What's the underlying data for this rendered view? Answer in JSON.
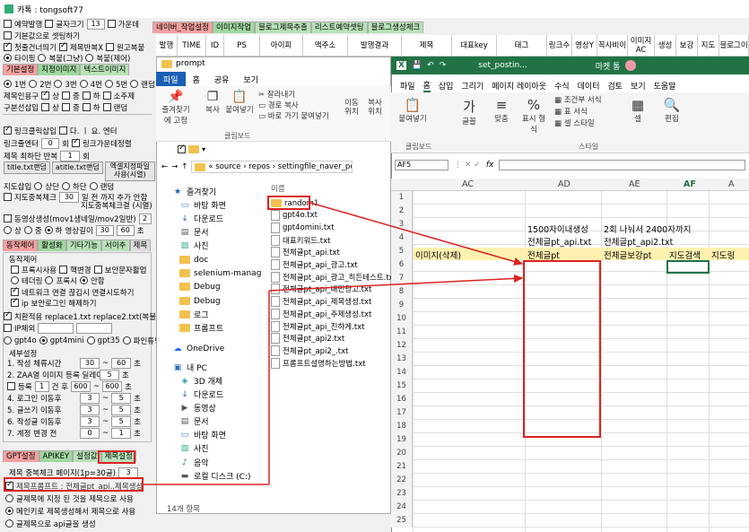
{
  "window": {
    "title": "카톡 : tongsoft77",
    "icon": "app-icon",
    "controls": [
      "–",
      "☐",
      "✕"
    ]
  },
  "left": {
    "row1": {
      "c1": "예약발행",
      "c2": "글자크기",
      "size": "13",
      "c3": "가운데"
    },
    "row2": "기본값으로 셋팅하기",
    "row3": {
      "c1": "첫줄건너띄기",
      "c2": "제목반복X",
      "c3": "원고복붙"
    },
    "row4": {
      "r1": "타이핑",
      "r2": "복붙(그냥)",
      "r3": "복붙(제어)"
    },
    "tabs1": [
      "기본설정",
      "지정이미지",
      "텍스트이미지"
    ],
    "row5": [
      "1번",
      "2번",
      "3번",
      "4번",
      "5번",
      "랜덤"
    ],
    "row6": {
      "label": "제목인용구",
      "a": "상",
      "b": "중",
      "c": "하",
      "d": "소주제"
    },
    "row7": {
      "label": "구분선삽입",
      "a": "상",
      "b": "중",
      "c": "하",
      "d": "랜덤"
    },
    "row8": {
      "c1": "링크클릭삽입",
      "c2": "다. ㅣ 요. 엔터"
    },
    "row9": {
      "label": "링크줄엔터",
      "val": "0",
      "unit": "회",
      "c1": "링크가운데정렬"
    },
    "row10": {
      "label": "제목 최하단 반복",
      "val": "1",
      "unit": "회"
    },
    "row11": {
      "b1": "title.txt랜덤",
      "b2": "atitle.txt랜덤",
      "b3": "엑셀지정파일 사용(시열)"
    },
    "row12": {
      "label": "지도삽입",
      "a": "상단",
      "b": "하단",
      "c": "랜덤"
    },
    "row13": {
      "c1": "지도중복체크",
      "val": "30",
      "text": "일 전 까지 추가 안함"
    },
    "row14": "지도중복체크결 (시열)",
    "row15": {
      "c1": "동영상생성(mov1생네일/mov2일반)",
      "val": "2"
    },
    "row16": {
      "a": "상",
      "b": "중",
      "c": "하",
      "label": "영상길이",
      "v1": "30",
      "v2": "60",
      "unit": "초"
    },
    "tabs2": [
      "동작제어",
      "활성화",
      "기타기능",
      "서이추",
      "제목"
    ],
    "sec1": "동작제어",
    "row17": {
      "c1": "프록시사용",
      "c2": "핵변경",
      "c3": "보안문자활업"
    },
    "row18": {
      "r1": "테더링",
      "r2": "프록시",
      "r3": "안함"
    },
    "row19": "네트워크 연결 끊김시 연결시도하기",
    "row20": "ip 보안로그인 해제하기",
    "row21": "치환적용 replace1.txt replace2.txt(복불)",
    "row22": "IP체외",
    "row23": [
      "gpt4o",
      "gpt4mini",
      "gpt35",
      "파인튜닝"
    ],
    "sec2": "세부설정",
    "rows": [
      {
        "label": "1. 작성 체류시간",
        "v1": "30",
        "v2": "60",
        "unit": "초"
      },
      {
        "label": "2. ZAA열 이미지 등록 딜레이",
        "v1": "5",
        "unit": "초"
      },
      {
        "label": "등록",
        "v0": "1",
        "mid": "건 후",
        "v1": "600",
        "v2": "600",
        "unit": "초"
      },
      {
        "label": "4. 로그인 이동후",
        "v1": "3",
        "v2": "5",
        "unit": "초"
      },
      {
        "label": "5. 글쓰기 이동후",
        "v1": "3",
        "v2": "5",
        "unit": "초"
      },
      {
        "label": "6. 작성글 이동후",
        "v1": "3",
        "v2": "5",
        "unit": "초"
      },
      {
        "label": "7. 계정 변경 전",
        "v1": "0",
        "v2": "1",
        "unit": "초"
      }
    ],
    "tabs3": [
      "GPT설정",
      "APIKEY",
      "설정값",
      "제목설정"
    ],
    "row24": {
      "label": "제목 중복체크 페이지(1p=30글)",
      "val": "3"
    },
    "row25": "제목프롬프트 : 전체글pt_api..제목생성",
    "row26": "글제목에 지정 된 것을 제목으로 사용",
    "row27": "메인키로 제목생성해서 제목으로 사용",
    "row28": "글제목으로 api글을 생성"
  },
  "toptabs": [
    "네이버_작업설정",
    "이미지작업",
    "블로그제목추출",
    "리스트예약셋팅",
    "블로그생성체크"
  ],
  "columns": [
    "발행",
    "TIME",
    "ID",
    "PS",
    "아이피",
    "맥주소",
    "발행결과",
    "제목",
    "대표key",
    "태그",
    "링크수",
    "영상Y",
    "꼭사비이",
    "이미지AC",
    "생성",
    "보강",
    "지도",
    "블로그이"
  ],
  "explorer": {
    "title": "prompt",
    "menu": [
      "파일",
      "홈",
      "공유",
      "보기"
    ],
    "ribbon": [
      "즐겨찾기에 고정",
      "복사",
      "붙여넣기",
      "잘라내기",
      "경로 복사",
      "바로 가기 붙여넣기",
      "이동 위치",
      "복사 위치"
    ],
    "group": "클립보드",
    "path": "« source › repos › settingfile_naver_posting_",
    "tree": [
      {
        "icon": "star-icon",
        "label": "즐겨찾기"
      },
      {
        "icon": "desktop-icon",
        "label": "바탕 화면"
      },
      {
        "icon": "download-icon",
        "label": "다운로드"
      },
      {
        "icon": "document-icon",
        "label": "문서"
      },
      {
        "icon": "picture-icon",
        "label": "사진"
      },
      {
        "icon": "folder-icon",
        "label": "doc"
      },
      {
        "icon": "folder-icon",
        "label": "selenium-manag"
      },
      {
        "icon": "folder-icon",
        "label": "Debug"
      },
      {
        "icon": "folder-icon",
        "label": "Debug"
      },
      {
        "icon": "folder-icon",
        "label": "로그"
      },
      {
        "icon": "folder-icon",
        "label": "프롬프트"
      },
      {
        "icon": "cloud-icon",
        "label": "OneDrive"
      },
      {
        "icon": "pc-icon",
        "label": "내 PC"
      },
      {
        "icon": "cube-icon",
        "label": "3D 개체"
      },
      {
        "icon": "download-icon",
        "label": "다운로드"
      },
      {
        "icon": "video-icon",
        "label": "동영상"
      },
      {
        "icon": "document-icon",
        "label": "문서"
      },
      {
        "icon": "desktop-icon",
        "label": "바탕 화면"
      },
      {
        "icon": "picture-icon",
        "label": "사진"
      },
      {
        "icon": "music-icon",
        "label": "음악"
      },
      {
        "icon": "disk-icon",
        "label": "로컬 디스크 (C:)"
      }
    ],
    "col": "이름",
    "files": [
      "random1",
      "gpt4o.txt",
      "gpt4omini.txt",
      "대표키워드.txt",
      "전체글pt_api.txt",
      "전체글pt_api_광고.txt",
      "전체글pt_api_광고_히든테스트.txt",
      "전체글pt_api_배민광고.txt",
      "전체글pt_api_제목생성.txt",
      "전체글pt_api_주제생성.txt",
      "전체글pt_api_진하게.txt",
      "전체글pt_api2.txt",
      "전체글pt_api2_.txt",
      "프롬프트설명하는방법.txt"
    ],
    "status": "14개 항목"
  },
  "excel": {
    "title": "set_postin...",
    "user": "마켓 통",
    "menu": [
      "파일",
      "홈",
      "삽입",
      "그리기",
      "페이지 레이아웃",
      "수식",
      "데이터",
      "검토",
      "보기",
      "도움말"
    ],
    "ribbon": [
      "붙여넣기",
      "글꼴",
      "맞춤",
      "표시 형식",
      "조건부 서식",
      "표 서식",
      "셀 스타일",
      "셀",
      "편집"
    ],
    "groups": [
      "클립보드",
      "스타일"
    ],
    "cellref": "AF5",
    "fx": "fx",
    "cols": [
      "AC",
      "AD",
      "AE",
      "AF",
      "A"
    ],
    "r2": {
      "ad": "1500자이내생성",
      "ae": "2회 나눠서 2400자까지"
    },
    "r3": {
      "ad": "전체글pt_api.txt",
      "ae": "전체글pt_api2.txt"
    },
    "r4": {
      "ac": "이미지(삭제)",
      "ad": "전체글pt",
      "ae": "전체글보강pt",
      "af": "지도검색",
      "ag": "지도링"
    },
    "rownums": [
      "1",
      "2",
      "3",
      "4",
      "5",
      "6",
      "7",
      "8",
      "9",
      "10",
      "11",
      "12",
      "13",
      "14",
      "15",
      "16",
      "17",
      "18",
      "19",
      "20",
      "21",
      "22",
      "23",
      "24",
      "25"
    ]
  }
}
